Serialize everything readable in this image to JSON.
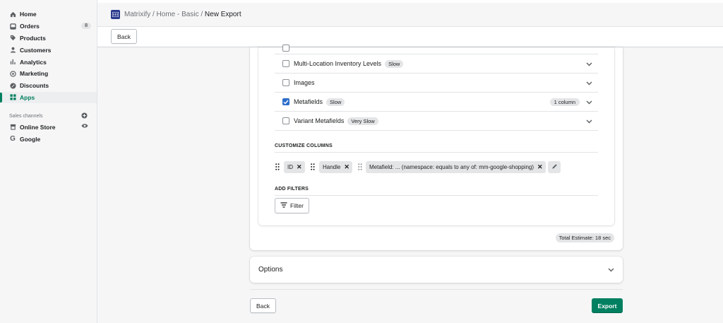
{
  "sidebar": {
    "items": [
      {
        "label": "Home",
        "icon": "home-icon"
      },
      {
        "label": "Orders",
        "icon": "orders-icon",
        "badge": "8"
      },
      {
        "label": "Products",
        "icon": "tag-icon"
      },
      {
        "label": "Customers",
        "icon": "person-icon"
      },
      {
        "label": "Analytics",
        "icon": "bar-chart-icon"
      },
      {
        "label": "Marketing",
        "icon": "target-icon"
      },
      {
        "label": "Discounts",
        "icon": "discount-icon"
      },
      {
        "label": "Apps",
        "icon": "apps-icon",
        "active": true
      }
    ],
    "sales_channels_title": "Sales channels",
    "channels": [
      {
        "label": "Online Store",
        "icon": "store-icon"
      },
      {
        "label": "Google",
        "icon": "google-icon"
      }
    ]
  },
  "header": {
    "breadcrumb_prefix": "Matrixify / Home - Basic / ",
    "breadcrumb_current": "New Export",
    "back_label": "Back"
  },
  "rows": [
    {
      "label": "Multi-Location Inventory Levels",
      "tag": "Slow",
      "checked": false
    },
    {
      "label": "Images",
      "tag": "",
      "checked": false
    },
    {
      "label": "Metafields",
      "tag": "Slow",
      "checked": true,
      "columns": "1 column"
    },
    {
      "label": "Variant Metafields",
      "tag": "Very Slow",
      "checked": false
    }
  ],
  "customize": {
    "title": "CUSTOMIZE COLUMNS",
    "tags": [
      "ID",
      "Handle",
      "Metafield: ... (namespace: equals to any of: mm-google-shopping)"
    ]
  },
  "filters": {
    "title": "ADD FILTERS",
    "button_label": "Filter"
  },
  "estimate": "Total Estimate: 18 sec",
  "options_label": "Options",
  "footer": {
    "back_label": "Back",
    "export_label": "Export"
  },
  "colors": {
    "accent": "#008060",
    "checkbox": "#2c6ecb",
    "app_logo": "#2b3a8e"
  }
}
